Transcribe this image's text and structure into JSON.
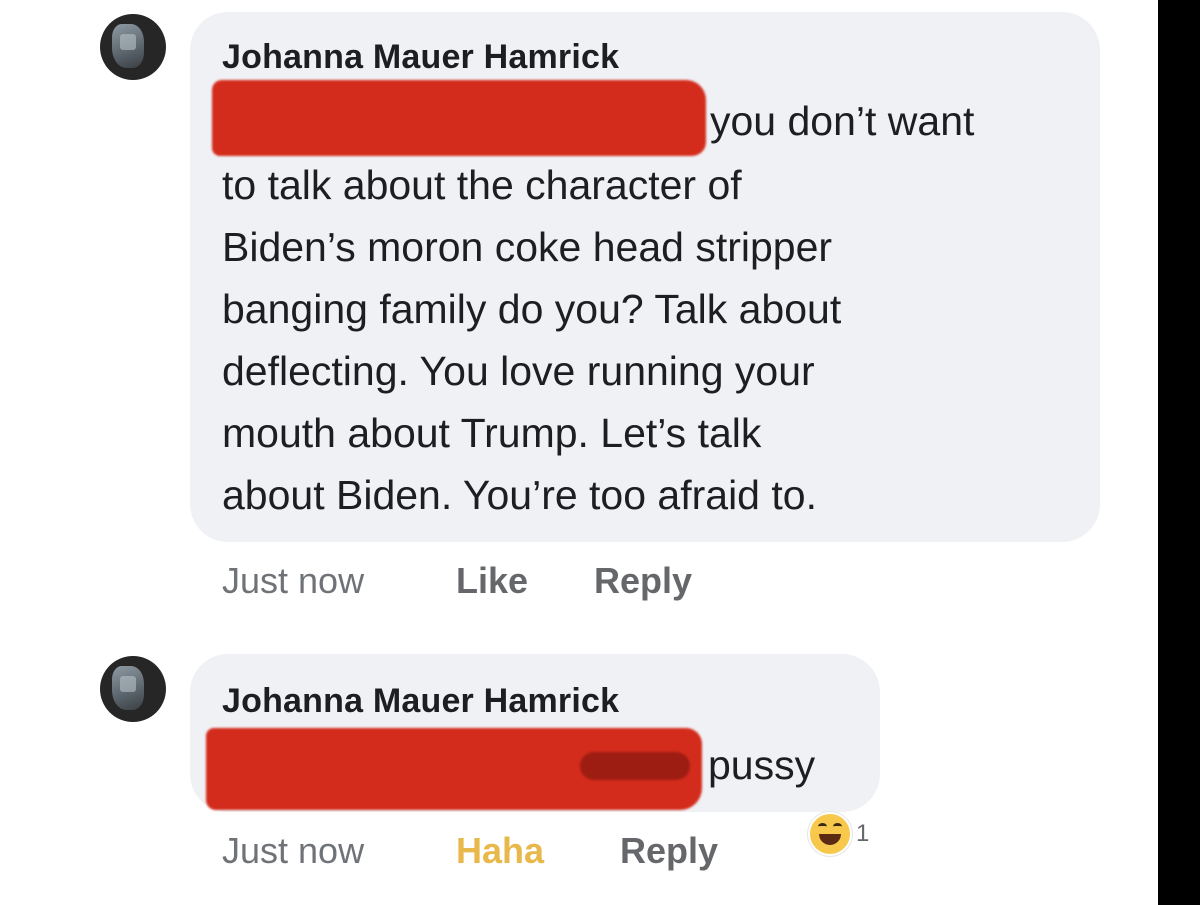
{
  "comments": [
    {
      "author": "Johanna Mauer Hamrick",
      "lines": [
        "you don’t want",
        "to talk about the character of",
        "Biden’s moron coke head stripper",
        "banging family do you? Talk about",
        "deflecting. You love running your",
        "mouth about Trump. Let’s talk",
        "about Biden. You’re too afraid to."
      ],
      "time": "Just now",
      "like_label": "Like",
      "reply_label": "Reply"
    },
    {
      "author": "Johanna Mauer Hamrick",
      "lines": [
        "pussy"
      ],
      "time": "Just now",
      "like_label": "Haha",
      "reply_label": "Reply",
      "reaction": {
        "icon": "haha-emoji-icon",
        "count": "1",
        "color": "#f7c84c"
      }
    }
  ],
  "colors": {
    "bubble": "#f0f1f5",
    "redaction": "#d32c1c",
    "haha_active": "#e8b84a"
  }
}
